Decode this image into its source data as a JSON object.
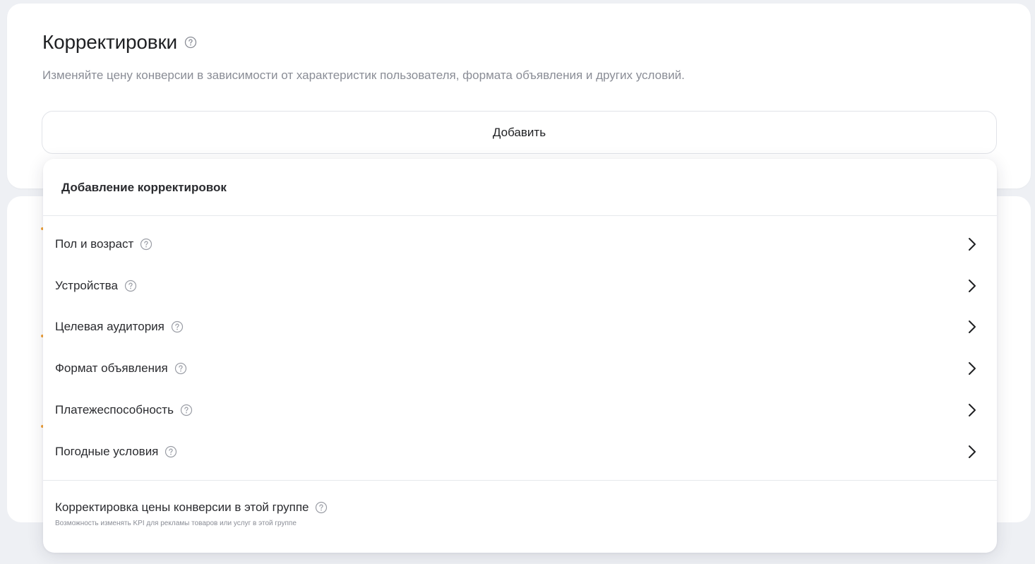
{
  "section": {
    "title": "Корректировки",
    "description": "Изменяйте цену конверсии в зависимости от характеристик пользователя, формата объявления и других условий.",
    "add_button_label": "Добавить"
  },
  "dropdown": {
    "header": "Добавление корректировок",
    "items": [
      {
        "label": "Пол и возраст",
        "icon": "help-icon",
        "chevron": "chevron-right-icon"
      },
      {
        "label": "Устройства",
        "icon": "help-icon",
        "chevron": "chevron-right-icon"
      },
      {
        "label": "Целевая аудитория",
        "icon": "help-icon",
        "chevron": "chevron-right-icon"
      },
      {
        "label": "Формат объявления",
        "icon": "help-icon",
        "chevron": "chevron-right-icon"
      },
      {
        "label": "Платежеспособность",
        "icon": "help-icon",
        "chevron": "chevron-right-icon"
      },
      {
        "label": "Погодные условия",
        "icon": "help-icon",
        "chevron": "chevron-right-icon"
      }
    ],
    "footer": {
      "title": "Корректировка цены конверсии в этой группе",
      "subtitle": "Возможность изменять KPI для рекламы товаров или услуг в этой группе"
    }
  },
  "colors": {
    "page_background": "#eef0f4",
    "text_primary": "#1f2023",
    "text_secondary": "#8a8d96",
    "accent_peek": "#f2a33a"
  }
}
